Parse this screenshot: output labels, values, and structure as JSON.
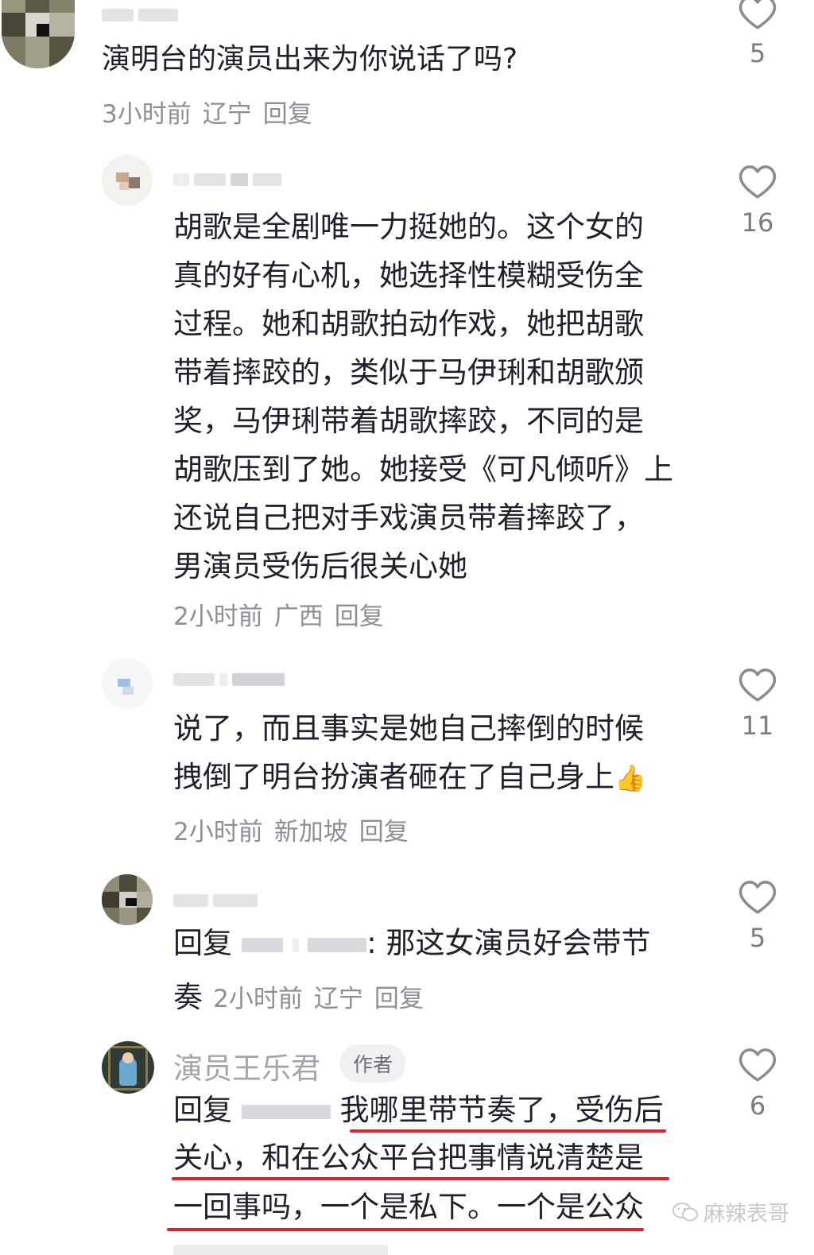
{
  "comments": [
    {
      "text": "演明台的演员出来为你说话了吗?",
      "time": "3小时前",
      "location": "辽宁",
      "reply_label": "回复",
      "likes": "5"
    },
    {
      "text": "胡歌是全剧唯一力挺她的。这个女的\n真的好有心机，她选择性模糊受伤全\n过程。她和胡歌拍动作戏，她把胡歌\n带着摔跤的，类似于马伊琍和胡歌颁\n奖，马伊琍带着胡歌摔跤，不同的是\n胡歌压到了她。她接受《可凡倾听》上\n还说自己把对手戏演员带着摔跤了，\n男演员受伤后很关心她",
      "time": "2小时前",
      "location": "广西",
      "reply_label": "回复",
      "likes": "16"
    },
    {
      "text": "说了，而且事实是她自己摔倒的时候\n拽倒了明台扮演者砸在了自己身上",
      "emoji": "👍",
      "time": "2小时前",
      "location": "新加坡",
      "reply_label": "回复",
      "likes": "11"
    },
    {
      "reply_prefix": "回复",
      "text_after": ": 那这女演员好会带节",
      "text_line2": "奏",
      "time": "2小时前",
      "location": "辽宁",
      "reply_label": "回复",
      "likes": "5"
    },
    {
      "author_name": "演员王乐君",
      "author_tag": "作者",
      "reply_prefix": "回复",
      "line1": "我哪里带节奏了，受伤后",
      "line2": "关心，和在公众平台把事情说清楚是",
      "line3": "一回事吗，一个是私下。一个是公众",
      "likes": "6"
    }
  ],
  "watermark": "麻辣表哥",
  "colors": {
    "underline": "#e0242c",
    "meta": "#8d8f96",
    "text": "#20212a"
  }
}
